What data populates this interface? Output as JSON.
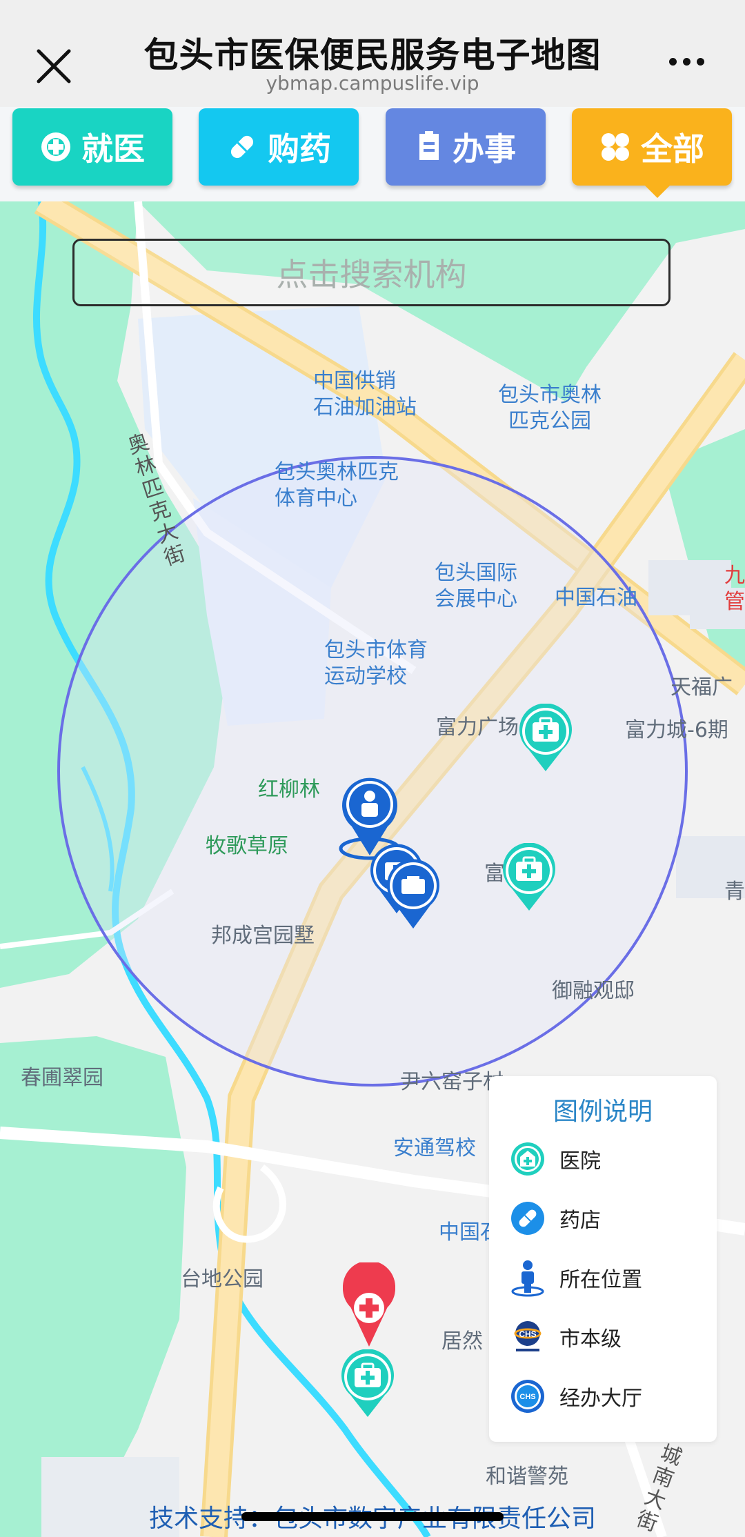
{
  "header": {
    "title": "包头市医保便民服务电子地图",
    "url": "ybmap.campuslife.vip"
  },
  "categories": [
    {
      "label": "就医",
      "icon": "medical-cross-icon",
      "color": "#19d4c3"
    },
    {
      "label": "购药",
      "icon": "pill-icon",
      "color": "#14c8f0"
    },
    {
      "label": "办事",
      "icon": "document-icon",
      "color": "#6487e1"
    },
    {
      "label": "全部",
      "icon": "four-leaf-icon",
      "color": "#fab21c"
    }
  ],
  "search": {
    "placeholder": "点击搜索机构"
  },
  "map_labels": {
    "gas_station": "中国供销\n石油加油站",
    "olympic_park": "包头市奥林\n匹克公园",
    "olympic_street": "奥林匹克大街",
    "sports_center": "包头奥林匹克\n体育中心",
    "expo_center": "包头国际\n会展中心",
    "petrochina": "中国石油",
    "sports_school": "包头市体育\n运动学校",
    "tianfu": "天福广",
    "fuli_plaza": "富力广场",
    "fuli_city": "富力城-6期",
    "hongliulin": "红柳林",
    "muge": "牧歌草原",
    "fu": "富",
    "bangcheng": "邦成宫园墅",
    "yurong": "御融观邸",
    "chunpu": "春圃翠园",
    "yinliu": "尹六窑子村",
    "antong": "安通驾校",
    "zhongguo": "中国石",
    "taidi": "台地公园",
    "juran": "居然",
    "hexie": "和谐警苑",
    "qing": "青",
    "jiu": "九\n管",
    "chengnan": "城南大街"
  },
  "legend": {
    "title": "图例说明",
    "items": [
      {
        "label": "医院",
        "icon": "hospital-icon"
      },
      {
        "label": "药店",
        "icon": "pharmacy-icon"
      },
      {
        "label": "所在位置",
        "icon": "location-person-icon"
      },
      {
        "label": "市本级",
        "icon": "chs-logo-icon"
      },
      {
        "label": "经办大厅",
        "icon": "service-hall-icon"
      }
    ]
  },
  "footer": {
    "text": "技术支持：包头市数字产业有限责任公司"
  },
  "colors": {
    "hospital": "#1fcfbe",
    "pharmacy": "#1c8fe8",
    "location": "#1a66d1",
    "red_marker": "#ee3b4e",
    "radius_circle": "#6a6ee6"
  }
}
